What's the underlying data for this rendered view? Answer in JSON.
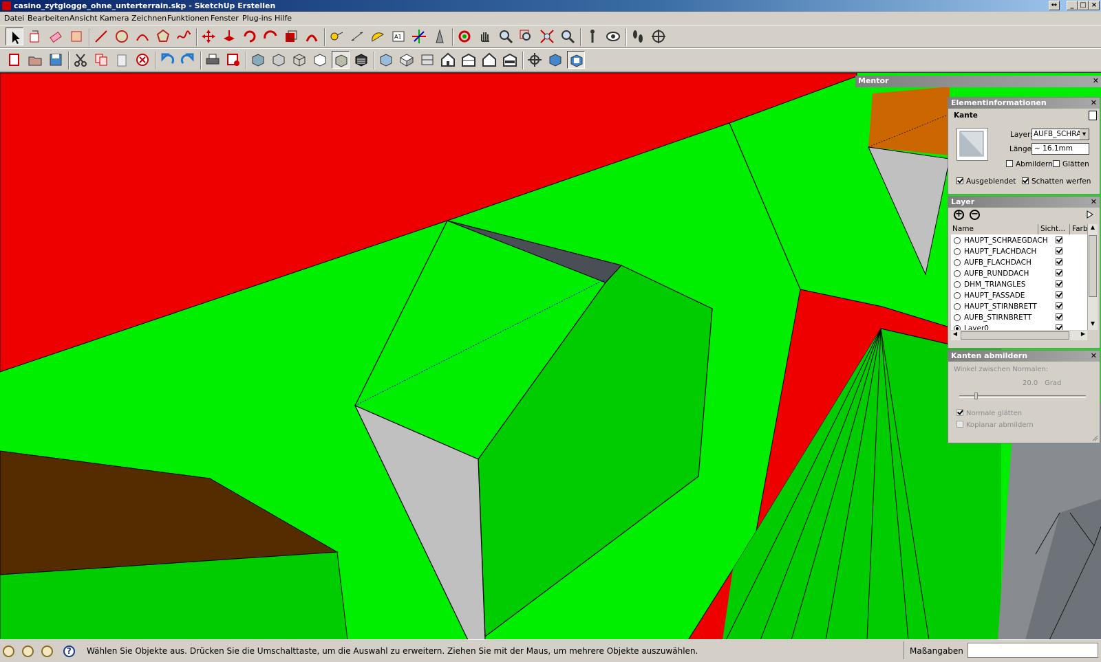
{
  "window": {
    "title": "casino_zytglogge_ohne_unterterrain.skp - SketchUp Erstellen"
  },
  "menu": [
    "Datei",
    "Bearbeiten",
    "Ansicht",
    "Kamera",
    "Zeichnen",
    "Funktionen",
    "Fenster",
    "Plug-ins",
    "Hilfe"
  ],
  "toolbar1": [
    "select-icon",
    "paint-bucket-icon",
    "eraser-icon",
    "rectangle-icon",
    "line-icon",
    "circle-icon",
    "arc-icon",
    "polygon-icon",
    "freehand-icon",
    "move-icon",
    "push-pull-icon",
    "rotate-icon",
    "follow-me-icon",
    "scale-icon",
    "offset-icon",
    "tape-measure-icon",
    "dimension-icon",
    "protractor-icon",
    "text-icon",
    "axes-icon",
    "3d-text-icon",
    "orbit-icon",
    "pan-icon",
    "zoom-icon",
    "zoom-window-icon",
    "zoom-extents-icon",
    "previous-view-icon",
    "position-camera-icon",
    "look-around-icon",
    "walk-icon",
    "section-plane-icon"
  ],
  "toolbar2": [
    "new-icon",
    "open-icon",
    "save-icon",
    "cut-icon",
    "copy-icon",
    "paste-icon",
    "delete-icon",
    "undo-icon",
    "redo-icon",
    "print-icon",
    "model-info-icon",
    "xray-icon",
    "back-edges-icon",
    "wireframe-icon",
    "hidden-line-icon",
    "shaded-icon",
    "shaded-textures-icon",
    "monochrome-icon",
    "iso-view-icon",
    "top-view-icon",
    "front-view-icon",
    "right-view-icon",
    "back-view-icon",
    "left-view-icon",
    "move-scene-icon",
    "scene-views-icon",
    "active-view-icon"
  ],
  "mentor": {
    "title": "Mentor"
  },
  "entity_info": {
    "title": "Elementinformationen",
    "type": "Kante",
    "layer_label": "Layer:",
    "layer_value": "AUFB_SCHRAE",
    "length_label": "Länge:",
    "length_value": "~ 16.1mm",
    "soften_label": "Abmildern",
    "smooth_label": "Glätten",
    "hidden_label": "Ausgeblendet",
    "cast_shadows_label": "Schatten werfen",
    "soften": false,
    "smooth": false,
    "hidden": true,
    "cast_shadows": true
  },
  "layers": {
    "title": "Layer",
    "col_name": "Name",
    "col_visible": "Sicht...",
    "col_color": "Farb",
    "rows": [
      {
        "name": "HAUPT_SCHRAEGDACH",
        "visible": true,
        "active": false
      },
      {
        "name": "HAUPT_FLACHDACH",
        "visible": true,
        "active": false
      },
      {
        "name": "AUFB_FLACHDACH",
        "visible": true,
        "active": false
      },
      {
        "name": "AUFB_RUNDDACH",
        "visible": true,
        "active": false
      },
      {
        "name": "DHM_TRIANGLES",
        "visible": true,
        "active": false
      },
      {
        "name": "HAUPT_FASSADE",
        "visible": true,
        "active": false
      },
      {
        "name": "HAUPT_STIRNBRETT",
        "visible": true,
        "active": false
      },
      {
        "name": "AUFB_STIRNBRETT",
        "visible": true,
        "active": false
      },
      {
        "name": "Layer0",
        "visible": true,
        "active": true
      }
    ]
  },
  "soften_edges": {
    "title": "Kanten abmildern",
    "angle_label": "Winkel zwischen Normalen:",
    "angle_value": "20.0",
    "angle_unit": "Grad",
    "slider_fraction": 0.12,
    "smooth_normals_label": "Normale glätten",
    "coplanar_label": "Koplanar abmildern",
    "smooth_normals": true,
    "coplanar": false
  },
  "status": {
    "message": "Wählen Sie Objekte aus. Drücken Sie die Umschalttaste, um die Auswahl zu erweitern. Ziehen Sie mit der Maus, um mehrere Objekte auszuwählen.",
    "measure_label": "Maßangaben",
    "measure_value": ""
  },
  "colors": {
    "green": "#00ee00",
    "dark_green": "#00cc00",
    "red": "#ee0000",
    "brown": "#552b00",
    "orange": "#cc6600",
    "grey": "#c0c0c0",
    "dark_grey": "#4a4f55"
  }
}
